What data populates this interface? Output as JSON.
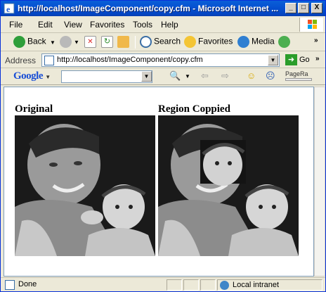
{
  "window": {
    "title": "http://localhost/ImageComponent/copy.cfm - Microsoft Internet ...",
    "controls": {
      "minimize": "_",
      "maximize": "□",
      "close": "X"
    }
  },
  "menu": {
    "items": [
      {
        "label": "File"
      },
      {
        "label": "Edit"
      },
      {
        "label": "View"
      },
      {
        "label": "Favorites"
      },
      {
        "label": "Tools"
      },
      {
        "label": "Help"
      }
    ]
  },
  "toolbar": {
    "back": "Back",
    "search": "Search",
    "favorites": "Favorites",
    "media": "Media",
    "overflow": "»"
  },
  "address": {
    "label": "Address",
    "url": "http://localhost/ImageComponent/copy.cfm",
    "go": "Go",
    "links_overflow": "»"
  },
  "google": {
    "logo": "Google",
    "search_value": "",
    "pagerank": "PageRa"
  },
  "page": {
    "left_heading": "Original",
    "right_heading": "Region Coppied"
  },
  "status": {
    "text": "Done",
    "zone": "Local intranet"
  },
  "colors": {
    "titlebar": "#0550d0",
    "chrome": "#ece9d8",
    "content_bg": "#ffffff"
  }
}
